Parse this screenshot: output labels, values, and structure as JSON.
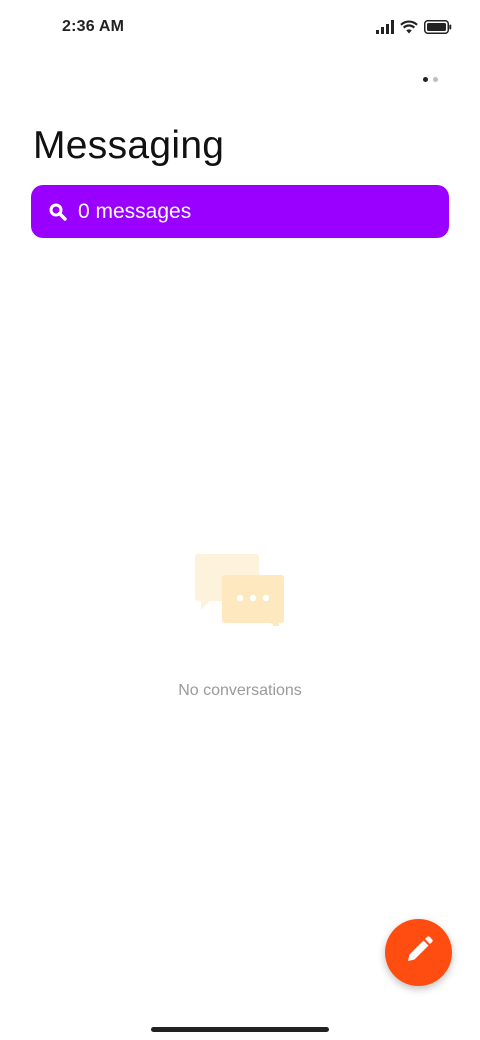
{
  "status_bar": {
    "time": "2:36 AM",
    "icons": [
      "signal-icon",
      "wifi-icon",
      "battery-icon"
    ]
  },
  "pager": {
    "page_count": 2,
    "active_page": 1
  },
  "header": {
    "title": "Messaging"
  },
  "search": {
    "label": "0 messages",
    "icon": "search-icon"
  },
  "empty_state": {
    "icon": "chat-bubbles-icon",
    "text": "No conversations"
  },
  "fab": {
    "icon": "pencil-icon"
  },
  "colors": {
    "search_background": "#9900ff",
    "fab_background": "#ff4d12",
    "illustration_light": "#fdf3dc",
    "illustration_main": "#fde8bf"
  }
}
